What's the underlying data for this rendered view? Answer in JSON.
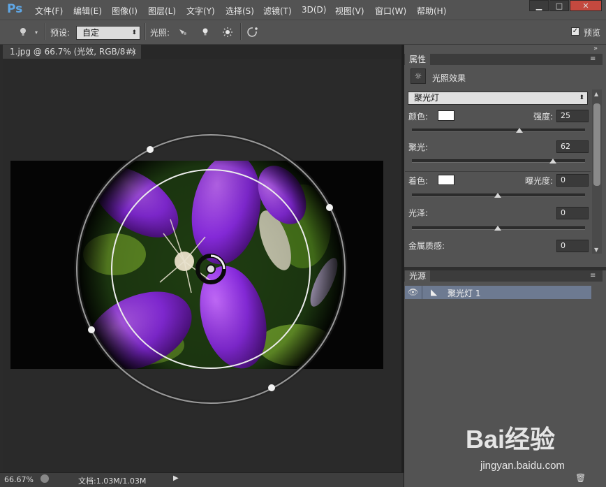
{
  "app": {
    "logo": "Ps"
  },
  "menu": [
    {
      "label": "文件(F)"
    },
    {
      "label": "编辑(E)"
    },
    {
      "label": "图像(I)"
    },
    {
      "label": "图层(L)"
    },
    {
      "label": "文字(Y)"
    },
    {
      "label": "选择(S)"
    },
    {
      "label": "滤镜(T)"
    },
    {
      "label": "3D(D)"
    },
    {
      "label": "视图(V)"
    },
    {
      "label": "窗口(W)"
    },
    {
      "label": "帮助(H)"
    }
  ],
  "window_buttons": {
    "minimize": "▁",
    "maximize": "□",
    "close": "✕"
  },
  "options_bar": {
    "preset_label": "预设:",
    "preset_value": "自定",
    "lights_label": "光照:",
    "preview_label": "预览",
    "preview_checked": "✓"
  },
  "document": {
    "tab_title": "1.jpg @ 66.7% (光效, RGB/8#) *",
    "tab_close": "×",
    "zoom": "66.67%",
    "doc_info": "文档:1.03M/1.03M"
  },
  "properties_panel": {
    "tab": "属性",
    "effect_title": "光照效果",
    "light_type": "聚光灯",
    "color_label": "颜色:",
    "intensity_label": "强度:",
    "intensity_value": "25",
    "intensity_fraction": 0.6,
    "hotspot_label": "聚光:",
    "hotspot_value": "62",
    "hotspot_fraction": 0.81,
    "colorize_label": "着色:",
    "exposure_label": "曝光度:",
    "exposure_value": "0",
    "exposure_fraction": 0.5,
    "gloss_label": "光泽:",
    "gloss_value": "0",
    "gloss_fraction": 0.5,
    "metallic_label": "金属质感:",
    "metallic_value": "0",
    "swatch_color": "#ffffff"
  },
  "lights_panel": {
    "tab": "光源",
    "lights": [
      {
        "label": "聚光灯 1"
      }
    ]
  },
  "colors": {
    "accent": "#5fa7e6",
    "selected_row": "#6d7a91",
    "flower": "#8a2be2"
  },
  "watermark": {
    "logo": "Bai经验",
    "url": "jingyan.baidu.com"
  }
}
